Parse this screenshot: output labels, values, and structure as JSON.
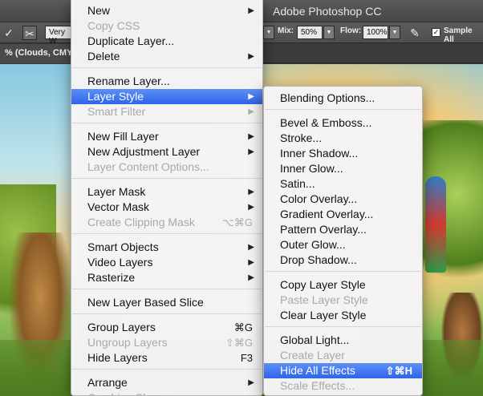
{
  "app": {
    "title": "Adobe Photoshop CC",
    "document_tab": "% (Clouds, CMYK"
  },
  "options_bar": {
    "preset": "Very W",
    "mix_label": "Mix:",
    "mix_value": "50%",
    "flow_label": "Flow:",
    "flow_value": "100%",
    "sample_all_label": "Sample All"
  },
  "layer_menu": {
    "items": [
      {
        "label": "New",
        "submenu": true
      },
      {
        "label": "Copy CSS",
        "disabled": true
      },
      {
        "label": "Duplicate Layer..."
      },
      {
        "label": "Delete",
        "submenu": true
      },
      {
        "label": "Rename Layer..."
      },
      {
        "label": "Layer Style",
        "submenu": true,
        "highlighted": true
      },
      {
        "label": "Smart Filter",
        "submenu": true,
        "disabled": true
      },
      {
        "label": "New Fill Layer",
        "submenu": true
      },
      {
        "label": "New Adjustment Layer",
        "submenu": true
      },
      {
        "label": "Layer Content Options...",
        "disabled": true
      },
      {
        "label": "Layer Mask",
        "submenu": true
      },
      {
        "label": "Vector Mask",
        "submenu": true
      },
      {
        "label": "Create Clipping Mask",
        "shortcut": "⌥⌘G",
        "disabled": true
      },
      {
        "label": "Smart Objects",
        "submenu": true
      },
      {
        "label": "Video Layers",
        "submenu": true
      },
      {
        "label": "Rasterize",
        "submenu": true
      },
      {
        "label": "New Layer Based Slice"
      },
      {
        "label": "Group Layers",
        "shortcut": "⌘G"
      },
      {
        "label": "Ungroup Layers",
        "shortcut": "⇧⌘G",
        "disabled": true
      },
      {
        "label": "Hide Layers",
        "shortcut": "F3"
      },
      {
        "label": "Arrange",
        "submenu": true
      },
      {
        "label": "Combine Shapes",
        "submenu": true,
        "disabled": true
      }
    ]
  },
  "layer_style_menu": {
    "items": [
      {
        "label": "Blending Options..."
      },
      {
        "label": "Bevel & Emboss..."
      },
      {
        "label": "Stroke..."
      },
      {
        "label": "Inner Shadow..."
      },
      {
        "label": "Inner Glow..."
      },
      {
        "label": "Satin..."
      },
      {
        "label": "Color Overlay..."
      },
      {
        "label": "Gradient Overlay..."
      },
      {
        "label": "Pattern Overlay..."
      },
      {
        "label": "Outer Glow..."
      },
      {
        "label": "Drop Shadow..."
      },
      {
        "label": "Copy Layer Style"
      },
      {
        "label": "Paste Layer Style",
        "disabled": true
      },
      {
        "label": "Clear Layer Style"
      },
      {
        "label": "Global Light..."
      },
      {
        "label": "Create Layer",
        "disabled": true
      },
      {
        "label": "Hide All Effects",
        "shortcut": "⇧⌘H",
        "highlighted": true
      },
      {
        "label": "Scale Effects...",
        "disabled": true
      }
    ]
  },
  "icons": {
    "submenu_arrow": "triangle-right-icon",
    "dropdown": "triangle-down-icon"
  },
  "colors": {
    "highlight": "#3a6fee",
    "menu_bg": "#f4f4f4",
    "disabled_text": "#a8a8a8"
  }
}
